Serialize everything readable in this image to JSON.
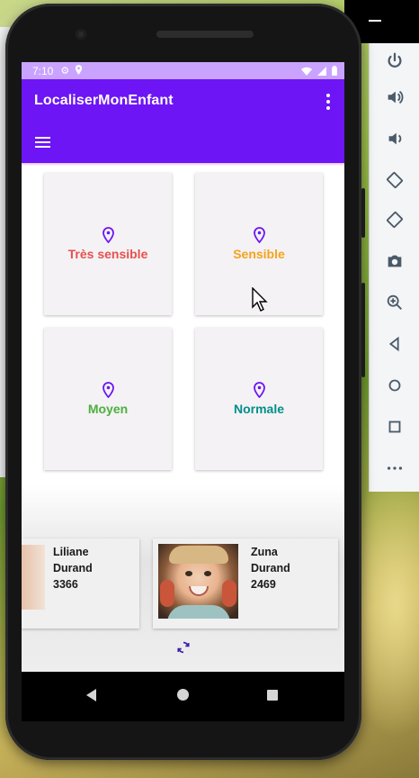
{
  "status_bar": {
    "time": "7:10",
    "icons": [
      "gear-icon",
      "location-icon",
      "wifi-icon",
      "signal-icon",
      "battery-icon"
    ]
  },
  "app_bar": {
    "title": "LocaliserMonEnfant",
    "color": "#6d15f5",
    "status_color": "#c9a3ff"
  },
  "zones": [
    {
      "label": "Très sensible",
      "color": "#e8504f",
      "icon": "location-pin-icon"
    },
    {
      "label": "Sensible",
      "color": "#f5a31b",
      "icon": "location-pin-icon"
    },
    {
      "label": "Moyen",
      "color": "#4caf3f",
      "icon": "location-pin-icon"
    },
    {
      "label": "Normale",
      "color": "#008f8c",
      "icon": "location-pin-icon"
    }
  ],
  "pin_color": "#6d15f5",
  "children": [
    {
      "first_name": "Liliane",
      "last_name": "Durand",
      "code": "3366"
    },
    {
      "first_name": "Zuna",
      "last_name": "Durand",
      "code": "2469"
    }
  ],
  "refresh_icon": "refresh-icon",
  "nav": [
    "back-icon",
    "home-icon",
    "recents-icon"
  ],
  "emulator_toolbar": [
    "power-icon",
    "volume-up-icon",
    "volume-down-icon",
    "rotate-left-icon",
    "rotate-right-icon",
    "camera-icon",
    "zoom-icon",
    "back-icon",
    "home-icon",
    "overview-icon",
    "more-icon"
  ]
}
